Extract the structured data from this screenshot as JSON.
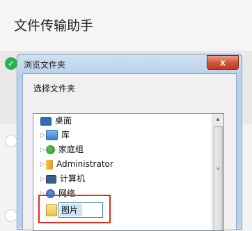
{
  "app": {
    "title": "文件传输助手"
  },
  "dialog": {
    "title": "浏览文件夹",
    "close_label": "x",
    "prompt": "选择文件夹",
    "tree": [
      {
        "label": "桌面",
        "icon": "desktop-icon",
        "expandable": false
      },
      {
        "label": "库",
        "icon": "library-icon",
        "expandable": true
      },
      {
        "label": "家庭组",
        "icon": "homegroup-icon",
        "expandable": true
      },
      {
        "label": "Administrator",
        "icon": "user-folder-icon",
        "expandable": true
      },
      {
        "label": "计算机",
        "icon": "computer-icon",
        "expandable": true
      },
      {
        "label": "网络",
        "icon": "network-icon",
        "expandable": true
      }
    ],
    "new_folder_name": "图片"
  },
  "colors": {
    "check_green": "#2bb24c",
    "highlight_red": "#e02a1c",
    "close_red": "#c23a1e"
  }
}
